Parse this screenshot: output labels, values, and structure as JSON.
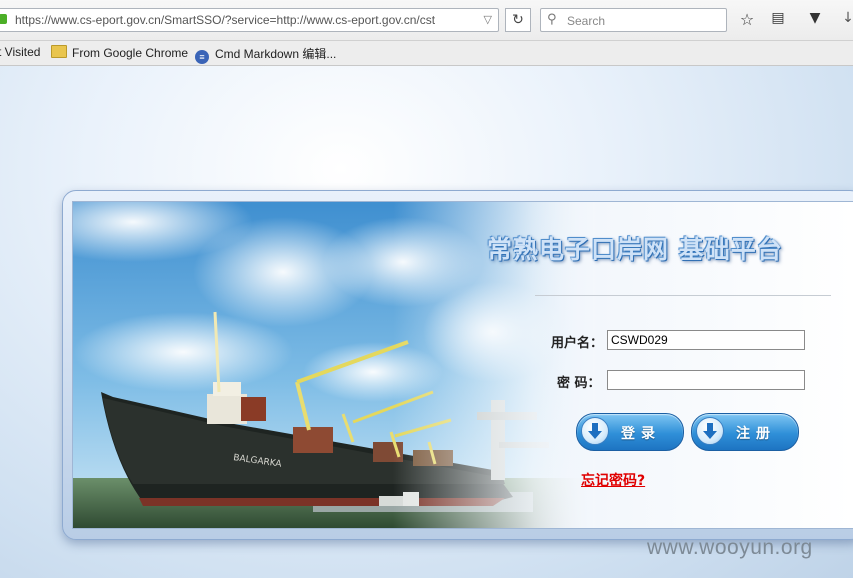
{
  "browser": {
    "url": "https://www.cs-eport.gov.cn/SmartSSO/?service=http://www.cs-eport.gov.cn/cst",
    "search_placeholder": "Search",
    "bookmarks": [
      {
        "label": "t Visited"
      },
      {
        "label": "From Google Chrome"
      },
      {
        "label": "Cmd Markdown 编辑..."
      }
    ]
  },
  "login": {
    "site_title": "常熟电子口岸网  基础平台",
    "username_label": "用户名：",
    "username_value": "CSWD029",
    "password_label": "密  码：",
    "password_value": "",
    "login_button": "登录",
    "register_button": "注册",
    "forgot_password": "忘记密码?",
    "ship_name": "BALGARKA"
  },
  "watermark": "www.wooyun.org",
  "colors": {
    "button_blue": "#2f8fd8",
    "forgot_red": "#e00000",
    "title_blue": "#2c6aaf"
  }
}
